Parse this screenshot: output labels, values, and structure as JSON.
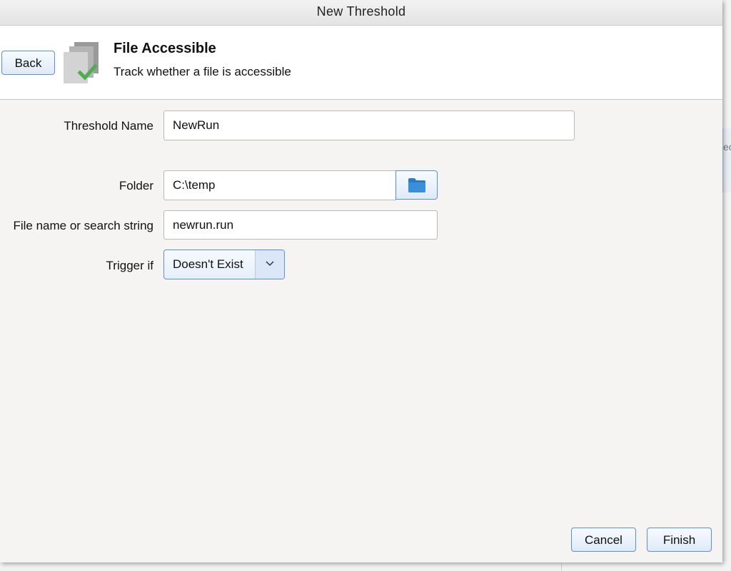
{
  "window": {
    "title": "New Threshold"
  },
  "header": {
    "back_label": "Back",
    "title": "File Accessible",
    "subtitle": "Track whether a file is accessible",
    "icon": "file-accessible-icon"
  },
  "form": {
    "threshold_name": {
      "label": "Threshold Name",
      "value": "NewRun"
    },
    "folder": {
      "label": "Folder",
      "value": "C:\\temp",
      "browse_icon": "folder-icon"
    },
    "file_name": {
      "label": "File name or search string",
      "value": "newrun.run"
    },
    "trigger": {
      "label": "Trigger if",
      "selected": "Doesn't Exist",
      "arrow_icon": "chevron-down-icon"
    }
  },
  "footer": {
    "cancel_label": "Cancel",
    "finish_label": "Finish"
  },
  "background": {
    "panel_text": "ec"
  },
  "colors": {
    "accent_border": "#5b8fd6",
    "check_green": "#4cae4f",
    "folder_blue": "#3a8fd8"
  }
}
